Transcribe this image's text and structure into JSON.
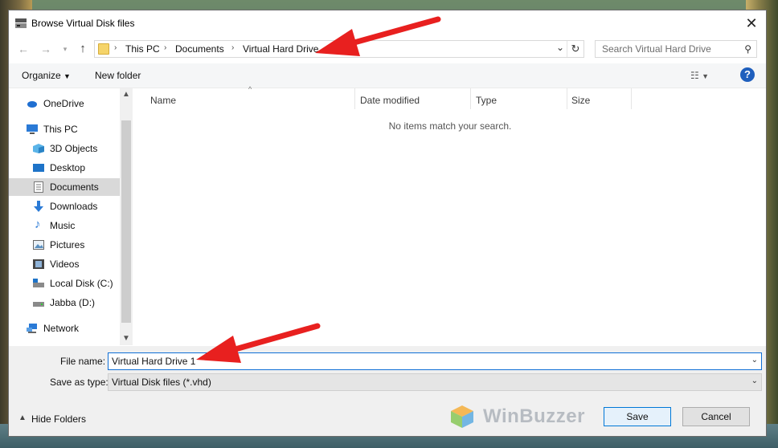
{
  "window": {
    "title": "Browse Virtual Disk files"
  },
  "address_bar": {
    "crumbs": [
      "This PC",
      "Documents",
      "Virtual Hard Drive"
    ]
  },
  "search": {
    "placeholder": "Search Virtual Hard Drive"
  },
  "toolbar": {
    "organize": "Organize",
    "new_folder": "New folder"
  },
  "sidebar": {
    "items": [
      {
        "label": "OneDrive",
        "icon": "cloud-icon"
      },
      {
        "label": "This PC",
        "icon": "monitor-icon"
      },
      {
        "label": "3D Objects",
        "icon": "cube-icon"
      },
      {
        "label": "Desktop",
        "icon": "desktop-icon"
      },
      {
        "label": "Documents",
        "icon": "document-icon",
        "selected": true
      },
      {
        "label": "Downloads",
        "icon": "download-arrow-icon"
      },
      {
        "label": "Music",
        "icon": "music-note-icon"
      },
      {
        "label": "Pictures",
        "icon": "picture-icon"
      },
      {
        "label": "Videos",
        "icon": "film-icon"
      },
      {
        "label": "Local Disk (C:)",
        "icon": "drive-icon"
      },
      {
        "label": "Jabba (D:)",
        "icon": "drive-icon"
      },
      {
        "label": "Network",
        "icon": "network-icon"
      }
    ]
  },
  "file_list": {
    "columns": [
      "Name",
      "Date modified",
      "Type",
      "Size"
    ],
    "empty_message": "No items match your search."
  },
  "bottom": {
    "file_name_label": "File name:",
    "file_name_value": "Virtual Hard Drive 1",
    "save_type_label": "Save as type:",
    "save_type_value": "Virtual Disk files (*.vhd)",
    "hide_folders": "Hide Folders",
    "save_button": "Save",
    "cancel_button": "Cancel"
  },
  "watermark": {
    "text": "WinBuzzer"
  },
  "colors": {
    "accent": "#0078d7",
    "annotation_arrow": "#e8201f",
    "selected_item": "#d9d9d9"
  }
}
